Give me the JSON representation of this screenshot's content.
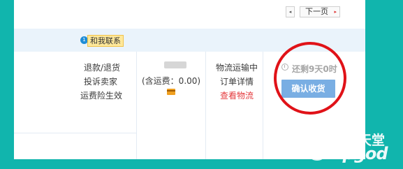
{
  "pager": {
    "prev_glyph": "◂",
    "next_label": "下一页",
    "next_glyph": "▸"
  },
  "header": {
    "chat_badge": "1",
    "chat_label": "和我联系"
  },
  "after_sales": {
    "refund": "退款/退货",
    "complain": "投诉卖家",
    "insurance": "运费险生效"
  },
  "price": {
    "shipping_note": "(含运费：0.00)"
  },
  "logistics": {
    "status": "物流运输中",
    "details": "订单详情",
    "view_logistics": "查看物流"
  },
  "confirm": {
    "countdown": "还剩9天0时",
    "button_label": "确认收货"
  },
  "watermark": {
    "mark": "P",
    "cn": "系统天堂",
    "en": "xpgod"
  },
  "colors": {
    "background": "#11b5ad",
    "confirm_button": "#79aee3",
    "link_red": "#e4393c",
    "annotation_circle": "#e01218"
  }
}
